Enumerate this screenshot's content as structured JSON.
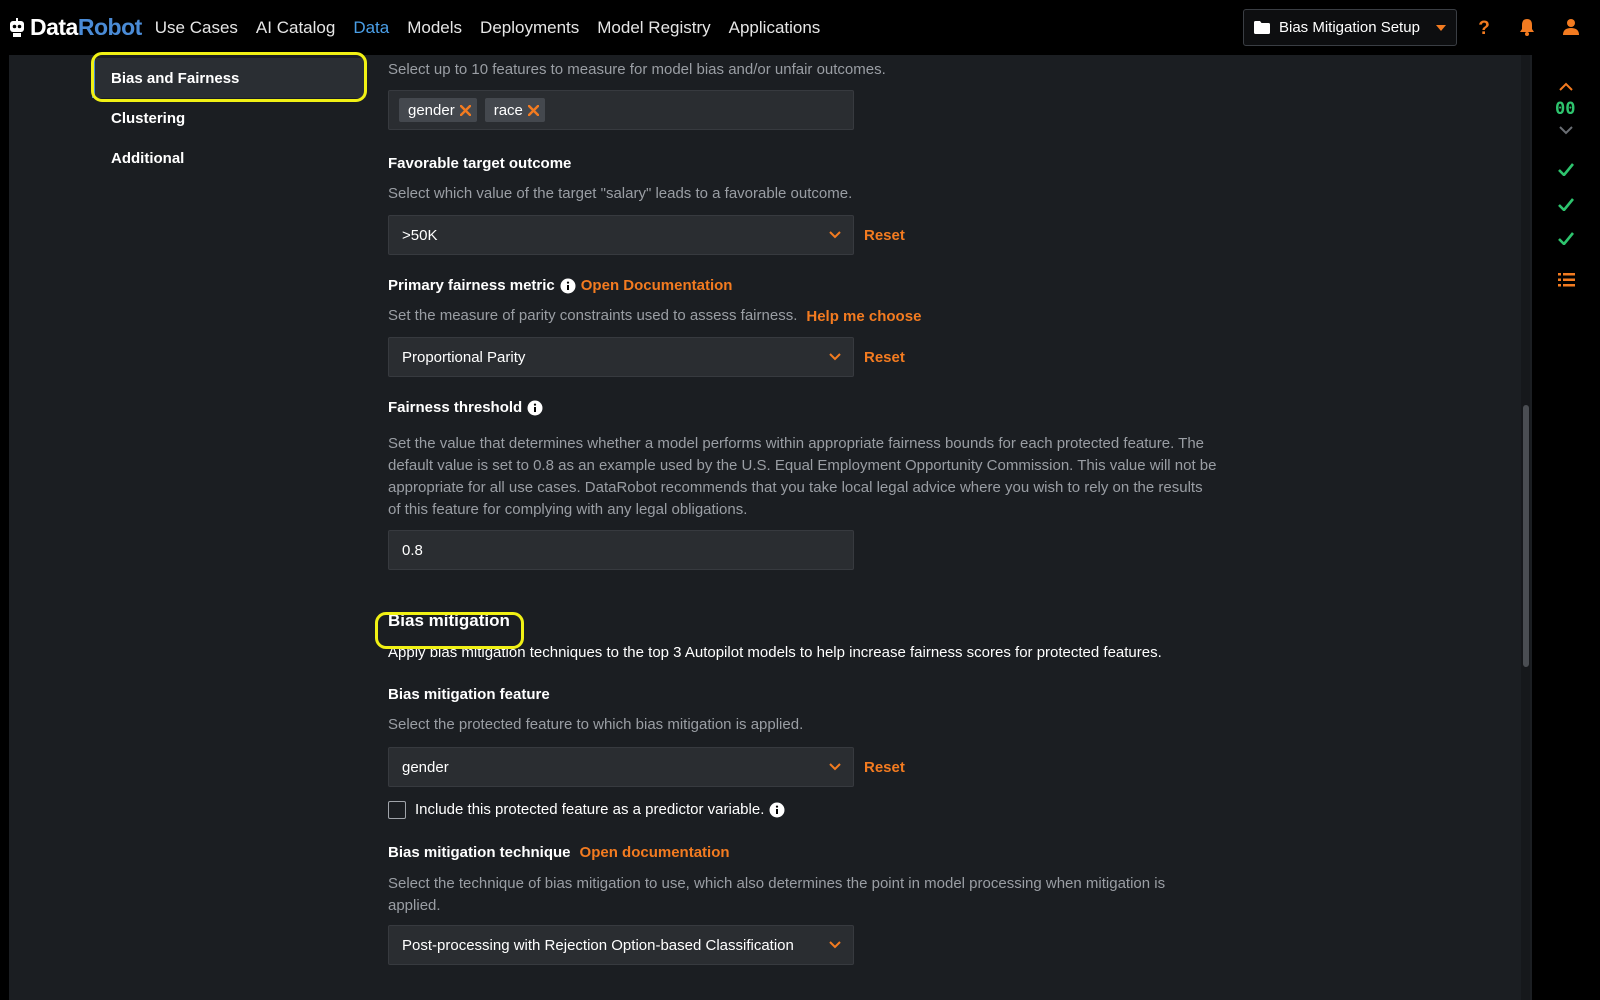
{
  "header": {
    "logo_data": "Data",
    "logo_robot": "Robot",
    "nav": [
      "Use Cases",
      "AI Catalog",
      "Data",
      "Models",
      "Deployments",
      "Model Registry",
      "Applications"
    ],
    "active_nav": "Data",
    "project": "Bias Mitigation Setup"
  },
  "sidebar": {
    "items": [
      {
        "label": "Bias and Fairness"
      },
      {
        "label": "Clustering"
      },
      {
        "label": "Additional"
      }
    ]
  },
  "protected": {
    "helper": "Select up to 10 features to measure for model bias and/or unfair outcomes.",
    "chips": [
      "gender",
      "race"
    ]
  },
  "favorable": {
    "label": "Favorable target outcome",
    "helper": "Select which value of the target \"salary\" leads to a favorable outcome.",
    "value": ">50K",
    "reset": "Reset"
  },
  "metric": {
    "label": "Primary fairness metric",
    "doc_link": "Open Documentation",
    "helper": "Set the measure of parity constraints used to assess fairness.",
    "help_link": "Help me choose",
    "value": "Proportional Parity",
    "reset": "Reset"
  },
  "threshold": {
    "label": "Fairness threshold",
    "helper": "Set the value that determines whether a model performs within appropriate fairness bounds for each protected feature. The default value is set to 0.8 as an example used by the U.S. Equal Employment Opportunity Commission. This value will not be appropriate for all use cases. DataRobot recommends that you take local legal advice where you wish to rely on the results of this feature for complying with any legal obligations.",
    "value": "0.8"
  },
  "mitigation": {
    "title": "Bias mitigation",
    "description": "Apply bias mitigation techniques to the top 3 Autopilot models to help increase fairness scores for protected features.",
    "feature_label": "Bias mitigation feature",
    "feature_helper": "Select the protected feature to which bias mitigation is applied.",
    "feature_value": "gender",
    "reset": "Reset",
    "checkbox_label": "Include this protected feature as a predictor variable.",
    "checkbox_checked": false,
    "technique_label": "Bias mitigation technique",
    "technique_link": "Open documentation",
    "technique_helper": "Select the technique of bias mitigation to use, which also determines the point in model processing when mitigation is applied.",
    "technique_value": "Post-processing with Rejection Option-based Classification"
  },
  "rail": {
    "counter": "00"
  },
  "colors": {
    "accent": "#f37b20",
    "link_blue": "#4a9fe8",
    "highlight": "#f1f114",
    "check_green": "#2ec46e"
  }
}
